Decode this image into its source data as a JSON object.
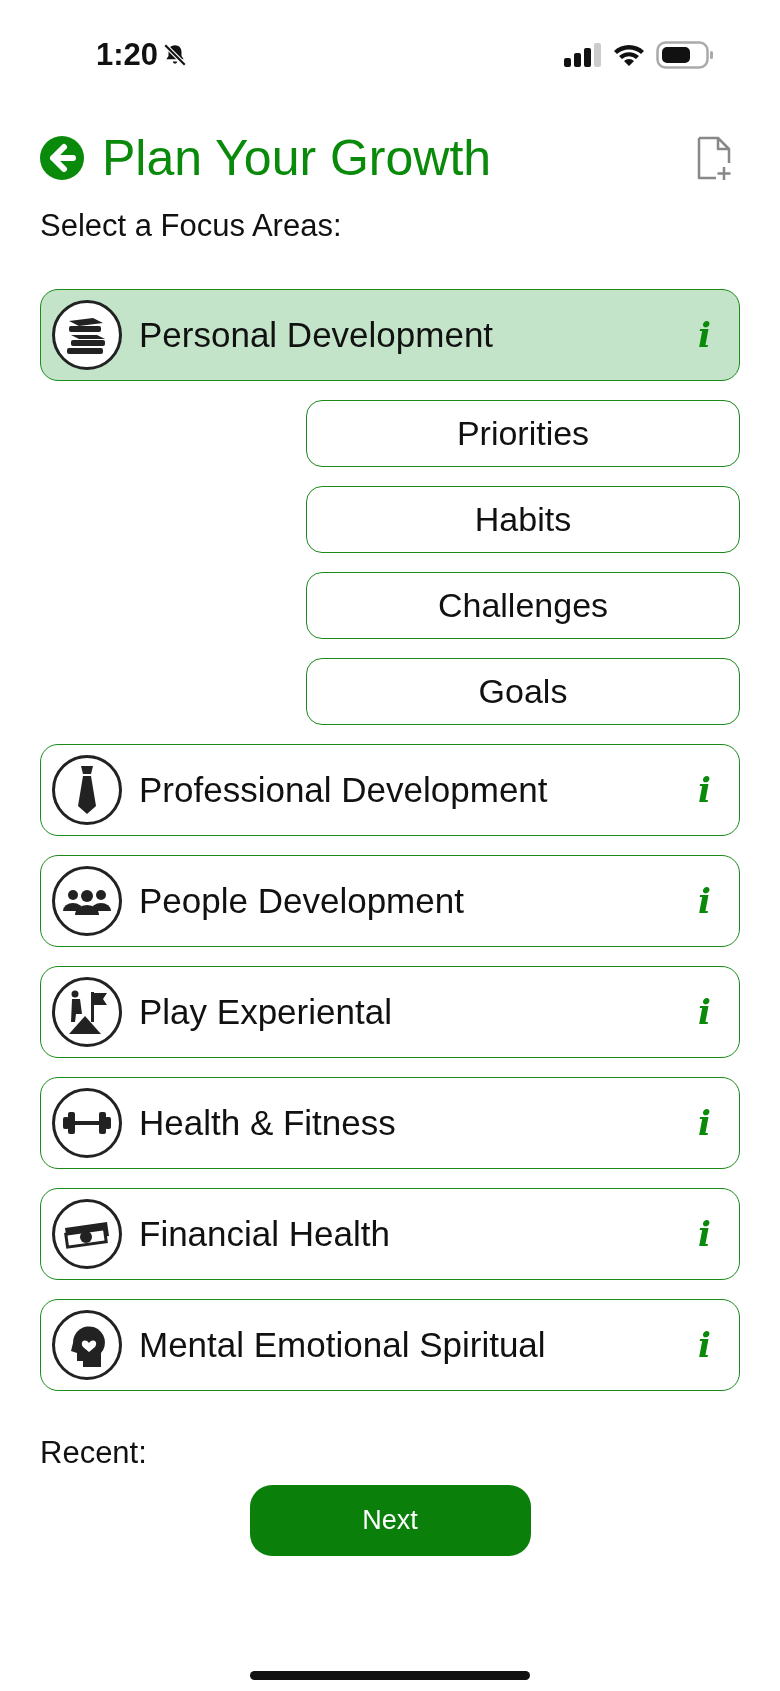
{
  "status_bar": {
    "time": "1:20"
  },
  "header": {
    "title": "Plan Your Growth"
  },
  "prompt": "Select a Focus Areas:",
  "areas": [
    {
      "label": "Personal Development",
      "selected": true,
      "info": "i",
      "children": [
        {
          "label": "Priorities"
        },
        {
          "label": "Habits"
        },
        {
          "label": "Challenges"
        },
        {
          "label": "Goals"
        }
      ]
    },
    {
      "label": "Professional Development",
      "selected": false,
      "info": "i"
    },
    {
      "label": "People Development",
      "selected": false,
      "info": "i"
    },
    {
      "label": "Play Experiental",
      "selected": false,
      "info": "i"
    },
    {
      "label": "Health & Fitness",
      "selected": false,
      "info": "i"
    },
    {
      "label": "Financial Health",
      "selected": false,
      "info": "i"
    },
    {
      "label": "Mental Emotional Spiritual",
      "selected": false,
      "info": "i"
    }
  ],
  "recent_label": "Recent:",
  "next_button": "Next"
}
